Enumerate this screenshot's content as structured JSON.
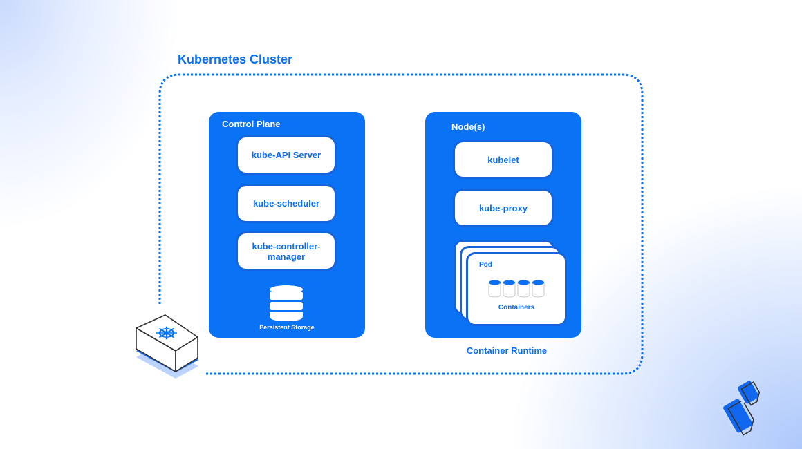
{
  "diagram": {
    "title": "Kubernetes Cluster",
    "colors": {
      "primary": "#0a72f5",
      "text_blue": "#0a6ff0",
      "border_dark": "#1664dc",
      "white": "#ffffff"
    },
    "control_plane": {
      "label": "Control Plane",
      "components": [
        {
          "label": "kube-API Server"
        },
        {
          "label": "kube-scheduler"
        },
        {
          "label": "kube-controller-\nmanager"
        }
      ],
      "storage": {
        "icon": "database-icon",
        "label": "Persistent Storage"
      }
    },
    "nodes": {
      "label": "Node(s)",
      "components": [
        {
          "label": "kubelet"
        },
        {
          "label": "kube-proxy"
        }
      ],
      "pod": {
        "label": "Pod",
        "containers_label": "Containers",
        "container_count": 4,
        "stack_count": 3
      },
      "runtime_label": "Container Runtime"
    },
    "icons": {
      "cluster": "kubernetes-helm-cube-icon",
      "brand": "brand-logo-icon"
    }
  }
}
